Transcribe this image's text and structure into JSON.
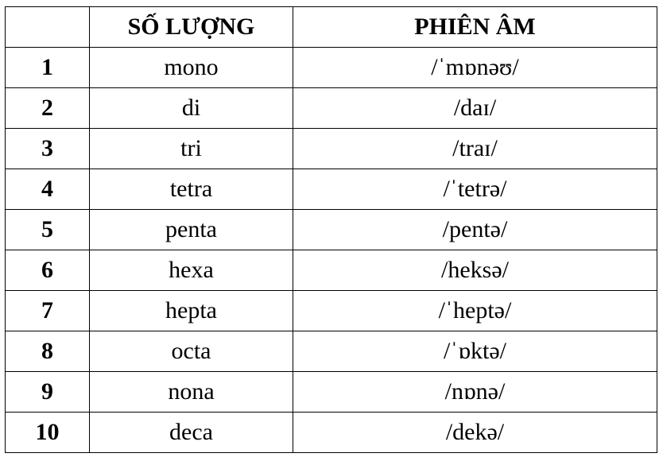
{
  "table": {
    "headers": [
      "",
      "SỐ LƯỢNG",
      "PHIÊN ÂM"
    ],
    "rows": [
      [
        "1",
        "mono",
        "/ˈmɒnəʊ/"
      ],
      [
        "2",
        "di",
        "/daɪ/"
      ],
      [
        "3",
        "tri",
        "/traɪ/"
      ],
      [
        "4",
        "tetra",
        "/ˈtetrə/"
      ],
      [
        "5",
        "penta",
        "/pentə/"
      ],
      [
        "6",
        "hexa",
        "/heksə/"
      ],
      [
        "7",
        "hepta",
        "/ˈheptə/"
      ],
      [
        "8",
        "octa",
        "/ˈɒktə/"
      ],
      [
        "9",
        "nona",
        "/nɒnə/"
      ],
      [
        "10",
        "deca",
        "/dekə/"
      ]
    ]
  }
}
